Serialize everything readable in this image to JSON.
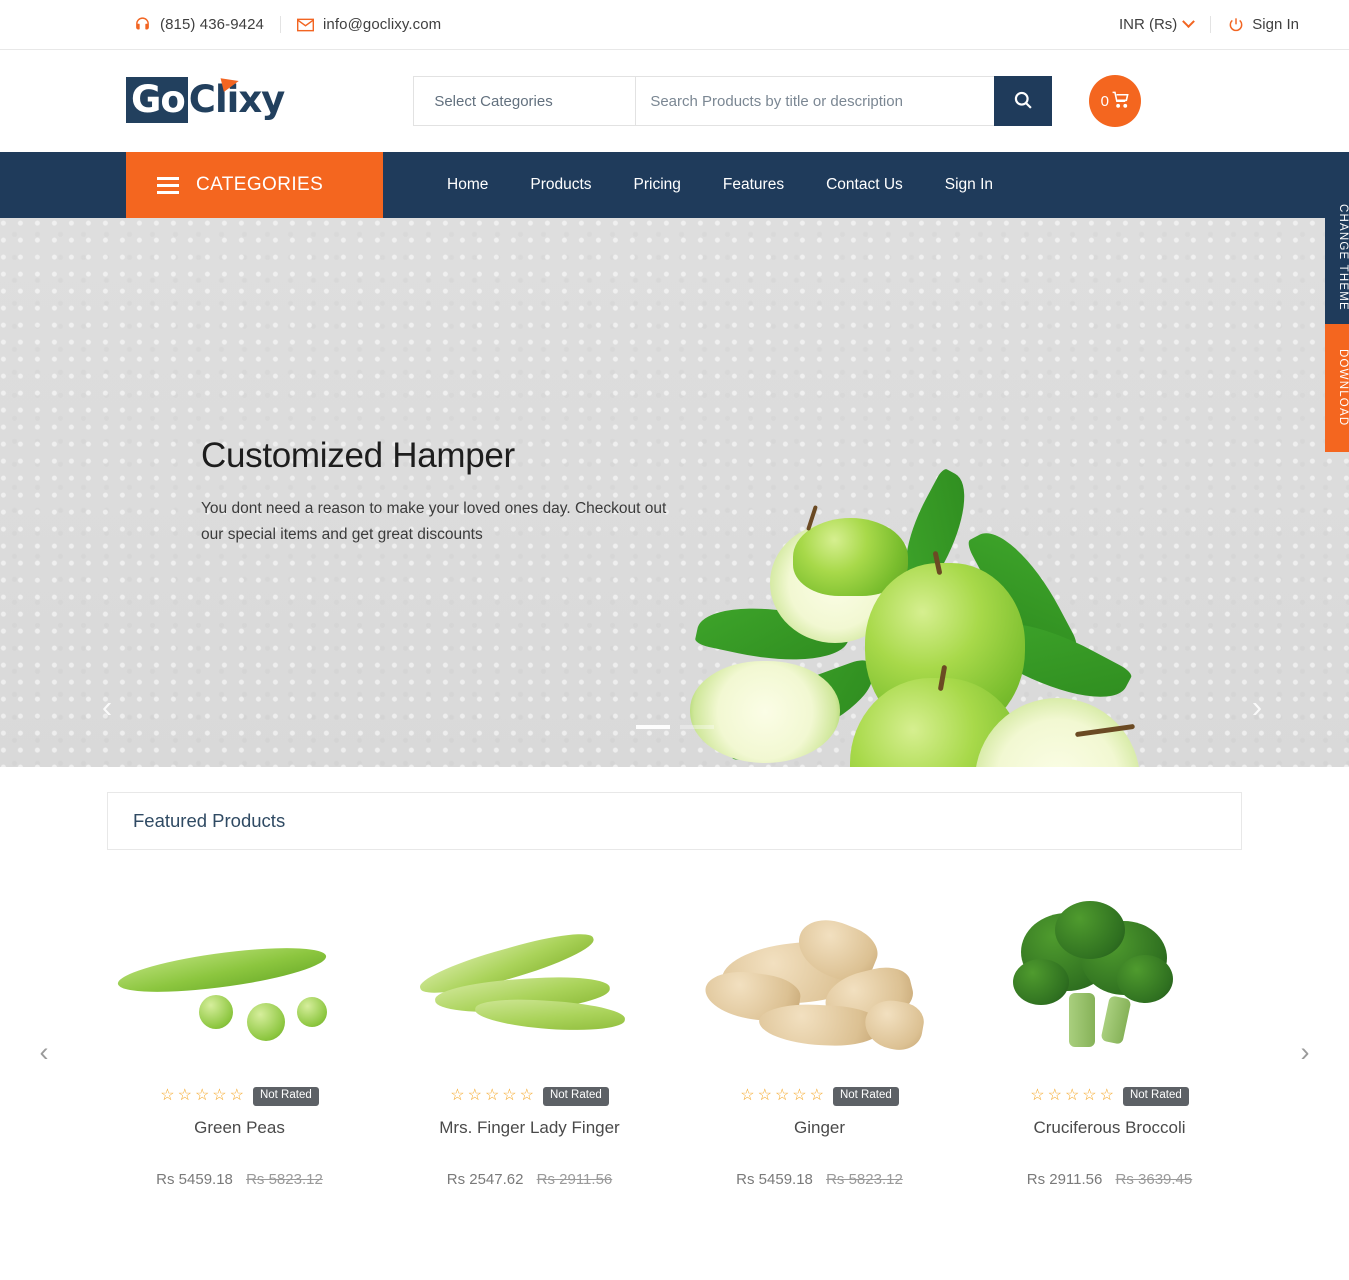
{
  "topbar": {
    "phone": "(815) 436-9424",
    "email": "info@goclixy.com",
    "phone_icon": "headset-icon",
    "email_icon": "envelope-icon",
    "currency": "INR (Rs)",
    "signin": "Sign In",
    "power_icon": "power-icon"
  },
  "header": {
    "logo_primary": "Go",
    "logo_secondary": "Clixy",
    "category_select": "Select Categories",
    "search_placeholder": "Search Products by title or description",
    "search_value": "",
    "search_icon": "magnifier-icon",
    "cart_count": "0",
    "cart_icon": "shopping-cart-icon"
  },
  "nav": {
    "categories_label": "CATEGORIES",
    "menu_icon": "hamburger-icon",
    "links": [
      {
        "label": "Home"
      },
      {
        "label": "Products"
      },
      {
        "label": "Pricing"
      },
      {
        "label": "Features"
      },
      {
        "label": "Contact Us"
      },
      {
        "label": "Sign In"
      }
    ]
  },
  "hero": {
    "title": "Customized Hamper",
    "subtitle": "You dont need a reason to make your loved ones day. Checkout out our special items and get great discounts",
    "prev_icon": "chevron-left-icon",
    "next_icon": "chevron-right-icon",
    "image_alt": "green-apples-image",
    "slides_total": 2,
    "active_slide": 1
  },
  "side_tabs": {
    "change_theme": "CHANGE THEME",
    "download": "DOWNLOAD"
  },
  "featured": {
    "heading": "Featured Products",
    "prev_icon": "chevron-left-icon",
    "next_icon": "chevron-right-icon",
    "rating_badge": "Not Rated",
    "stars_empty": "☆☆☆☆☆",
    "products": [
      {
        "name": "Green Peas",
        "price": "Rs 5459.18",
        "old_price": "Rs 5823.12",
        "badge": "Not Rated",
        "image": "green-peas-image"
      },
      {
        "name": "Mrs. Finger Lady Finger",
        "price": "Rs 2547.62",
        "old_price": "Rs 2911.56",
        "badge": "Not Rated",
        "image": "okra-image"
      },
      {
        "name": "Ginger",
        "price": "Rs 5459.18",
        "old_price": "Rs 5823.12",
        "badge": "Not Rated",
        "image": "ginger-image"
      },
      {
        "name": "Cruciferous Broccoli",
        "price": "Rs 2911.56",
        "old_price": "Rs 3639.45",
        "badge": "Not Rated",
        "image": "broccoli-image"
      }
    ]
  },
  "colors": {
    "accent_orange": "#f4661f",
    "navy": "#1f3b5b",
    "star_gold": "#f5a623",
    "badge_gray": "#5d6166"
  }
}
